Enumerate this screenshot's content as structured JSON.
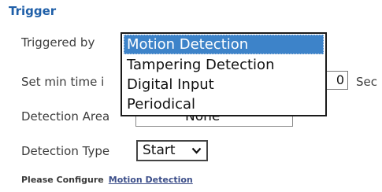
{
  "trigger": {
    "section_title": "Trigger",
    "triggered_by_label": "Triggered by",
    "min_time_label": "Set min time i",
    "min_time_value": "0",
    "min_time_unit": "Sec",
    "detection_area_label": "Detection Area",
    "detection_area_value": "None",
    "detection_type_label": "Detection Type",
    "detection_type_value": "Start",
    "configure_prefix": "Please Configure",
    "configure_link": "Motion Detection"
  },
  "dropdown": {
    "selected": "Motion Detection",
    "options": [
      "Motion Detection",
      "Tampering Detection",
      "Digital Input",
      "Periodical"
    ]
  },
  "colors": {
    "section_title": "#1f5fa8",
    "highlight": "#3d83c9",
    "link": "#3d4f8a"
  }
}
